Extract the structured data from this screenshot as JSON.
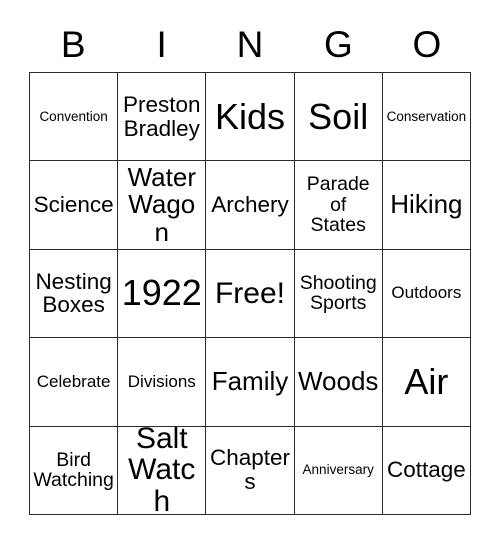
{
  "card": {
    "title": "BINGO",
    "columns": [
      "B",
      "I",
      "N",
      "G",
      "O"
    ],
    "free_space_label": "Free!",
    "rows": [
      [
        {
          "text": "Convention",
          "size": "fs-13"
        },
        {
          "text": "Preston\nBradley",
          "size": "fs-22"
        },
        {
          "text": "Kids",
          "size": "fs-36"
        },
        {
          "text": "Soil",
          "size": "fs-36"
        },
        {
          "text": "Conservation",
          "size": "fs-13"
        }
      ],
      [
        {
          "text": "Science",
          "size": "fs-22"
        },
        {
          "text": "Water\nWagon",
          "size": "fs-26"
        },
        {
          "text": "Archery",
          "size": "fs-22"
        },
        {
          "text": "Parade\nof\nStates",
          "size": "fs-19"
        },
        {
          "text": "Hiking",
          "size": "fs-26"
        }
      ],
      [
        {
          "text": "Nesting\nBoxes",
          "size": "fs-22"
        },
        {
          "text": "1922",
          "size": "fs-36"
        },
        {
          "text": "Free!",
          "size": "fs-30"
        },
        {
          "text": "Shooting\nSports",
          "size": "fs-19"
        },
        {
          "text": "Outdoors",
          "size": "fs-17"
        }
      ],
      [
        {
          "text": "Celebrate",
          "size": "fs-17"
        },
        {
          "text": "Divisions",
          "size": "fs-17"
        },
        {
          "text": "Family",
          "size": "fs-26"
        },
        {
          "text": "Woods",
          "size": "fs-26"
        },
        {
          "text": "Air",
          "size": "fs-36"
        }
      ],
      [
        {
          "text": "Bird\nWatching",
          "size": "fs-19"
        },
        {
          "text": "Salt\nWatch",
          "size": "fs-30"
        },
        {
          "text": "Chapters",
          "size": "fs-22"
        },
        {
          "text": "Anniversary",
          "size": "fs-13"
        },
        {
          "text": "Cottage",
          "size": "fs-22"
        }
      ]
    ]
  },
  "colors": {
    "background": "#ffffff",
    "text": "#000000",
    "grid_line": "#2b2b2b"
  }
}
